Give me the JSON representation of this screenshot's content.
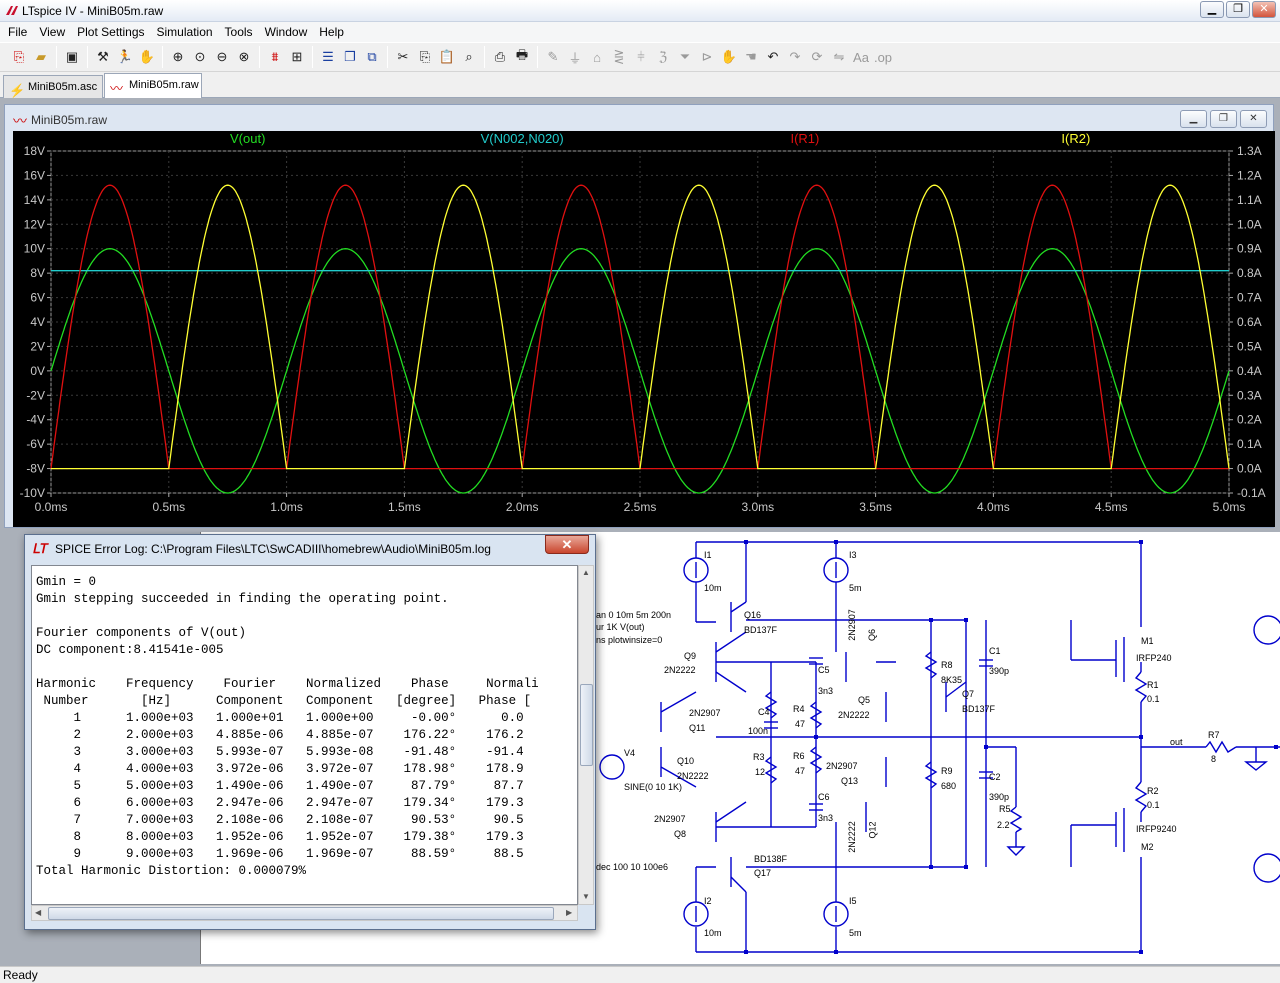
{
  "app": {
    "title": "LTspice IV - MiniB05m.raw"
  },
  "window_controls": {
    "minimize": "▁",
    "maximize": "❐",
    "close": "✕"
  },
  "menu": [
    "File",
    "View",
    "Plot Settings",
    "Simulation",
    "Tools",
    "Window",
    "Help"
  ],
  "toolbar": {
    "icons": [
      "new-schematic-icon",
      "open-icon",
      "save-icon",
      "control-panel-icon",
      "run-icon",
      "halt-icon",
      "zoom-in-icon",
      "zoom-full-icon",
      "zoom-out-icon",
      "zoom-cancel-icon",
      "autorange-icon",
      "manual-limits-icon",
      "tile-horizontal-icon",
      "cascade-icon",
      "close-all-icon",
      "cut-icon",
      "copy-icon",
      "paste-icon",
      "find-icon",
      "print-preview-icon",
      "print-icon",
      "wire-icon",
      "ground-icon",
      "label-icon",
      "resistor-icon",
      "capacitor-icon",
      "inductor-icon",
      "diode-icon",
      "component-icon",
      "move-icon",
      "drag-icon",
      "undo-icon",
      "redo-icon",
      "rotate-icon",
      "mirror-icon",
      "text-icon",
      "spice-directive-icon"
    ]
  },
  "tabs": [
    {
      "label": "MiniB05m.asc",
      "active": false
    },
    {
      "label": "MiniB05m.raw",
      "active": true
    }
  ],
  "plot_window": {
    "title": "MiniB05m.raw",
    "colors": {
      "bg": "#000000",
      "grid": "#3a3a3a",
      "axis_text": "#c8c8c8"
    }
  },
  "chart_data": {
    "type": "line",
    "title": "",
    "xlabel": "",
    "ylabel": "",
    "x_ticks": [
      "0.0ms",
      "0.5ms",
      "1.0ms",
      "1.5ms",
      "2.0ms",
      "2.5ms",
      "3.0ms",
      "3.5ms",
      "4.0ms",
      "4.5ms",
      "5.0ms"
    ],
    "y_left_ticks": [
      "18V",
      "16V",
      "14V",
      "12V",
      "10V",
      "8V",
      "6V",
      "4V",
      "2V",
      "0V",
      "-2V",
      "-4V",
      "-6V",
      "-8V",
      "-10V"
    ],
    "y_right_ticks": [
      "1.3A",
      "1.2A",
      "1.1A",
      "1.0A",
      "0.9A",
      "0.8A",
      "0.7A",
      "0.6A",
      "0.5A",
      "0.4A",
      "0.3A",
      "0.2A",
      "0.1A",
      "0.0A",
      "-0.1A"
    ],
    "xlim": [
      0,
      5
    ],
    "ylim_left": [
      -10,
      18
    ],
    "ylim_right": [
      -0.1,
      1.3
    ],
    "series": [
      {
        "name": "V(out)",
        "color": "#22dd22",
        "axis": "left",
        "shape": "sine",
        "amplitude": 10,
        "offset": 0,
        "frequency_khz": 1,
        "phase_deg": 0
      },
      {
        "name": "V(N002,N020)",
        "color": "#22cccc",
        "axis": "left",
        "shape": "constant",
        "value": 8.2
      },
      {
        "name": "I(R1)",
        "color": "#e01010",
        "axis": "right",
        "shape": "half-sine",
        "peak": 1.16,
        "floor": 0.0,
        "frequency_khz": 1,
        "phase_deg": 0
      },
      {
        "name": "I(R2)",
        "color": "#ffff33",
        "axis": "right",
        "shape": "half-sine",
        "peak": 1.16,
        "floor": 0.0,
        "frequency_khz": 1,
        "phase_deg": 180
      }
    ]
  },
  "error_log": {
    "title": "SPICE Error Log: C:\\Program Files\\LTC\\SwCADIII\\homebrew\\Audio\\MiniB05m.log",
    "close_label": "✕",
    "lines": [
      "Gmin = 0",
      "Gmin stepping succeeded in finding the operating point.",
      "",
      "Fourier components of V(out)",
      "DC component:8.41541e-005",
      "",
      "Harmonic    Frequency    Fourier    Normalized    Phase     Normali",
      " Number       [Hz]      Component   Component   [degree]   Phase [",
      "     1      1.000e+03   1.000e+01   1.000e+00     -0.00°      0.0",
      "     2      2.000e+03   4.885e-06   4.885e-07    176.22°    176.2",
      "     3      3.000e+03   5.993e-07   5.993e-08    -91.48°    -91.4",
      "     4      4.000e+03   3.972e-06   3.972e-07    178.98°    178.9",
      "     5      5.000e+03   1.490e-06   1.490e-07     87.79°     87.7",
      "     6      6.000e+03   2.947e-06   2.947e-07    179.34°    179.3",
      "     7      7.000e+03   2.108e-06   2.108e-07     90.53°     90.5",
      "     8      8.000e+03   1.952e-06   1.952e-07    179.38°    179.3",
      "     9      9.000e+03   1.969e-06   1.969e-07     88.59°     88.5",
      "Total Harmonic Distortion: 0.000079%"
    ]
  },
  "schematic": {
    "directives": [
      "an 0 10m 5m 200n",
      "ur 1K V(out)",
      "ns plotwinsize=0",
      "dec 100 10 100e6"
    ],
    "labels": [
      "I1",
      "10m",
      "I3",
      "5m",
      "Q16",
      "BD137F",
      "Q9",
      "2N2222",
      "Q11",
      "2N2907",
      "Q10",
      "2N2222",
      "V4",
      "SINE(0 10 1K)",
      "Q8",
      "2N2907",
      "Q17",
      "BD138F",
      "I2",
      "10m",
      "I5",
      "5m",
      "C4",
      "100n",
      "R3",
      "12",
      "C5",
      "3n3",
      "R4",
      "47",
      "R6",
      "47",
      "C6",
      "3n3",
      "Q6",
      "2N2907",
      "Q5",
      "2N2222",
      "Q13",
      "2N2907",
      "Q12",
      "2N2222",
      "R8",
      "8K35",
      "Q7",
      "BD137F",
      "R9",
      "680",
      "C1",
      "390p",
      "C2",
      "390p",
      "R5",
      "2.2",
      "M1",
      "IRFP240",
      "R1",
      "0.1",
      "R2",
      "0.1",
      "M2",
      "IRFP9240",
      "R7",
      "8",
      "out"
    ]
  },
  "status": "Ready"
}
